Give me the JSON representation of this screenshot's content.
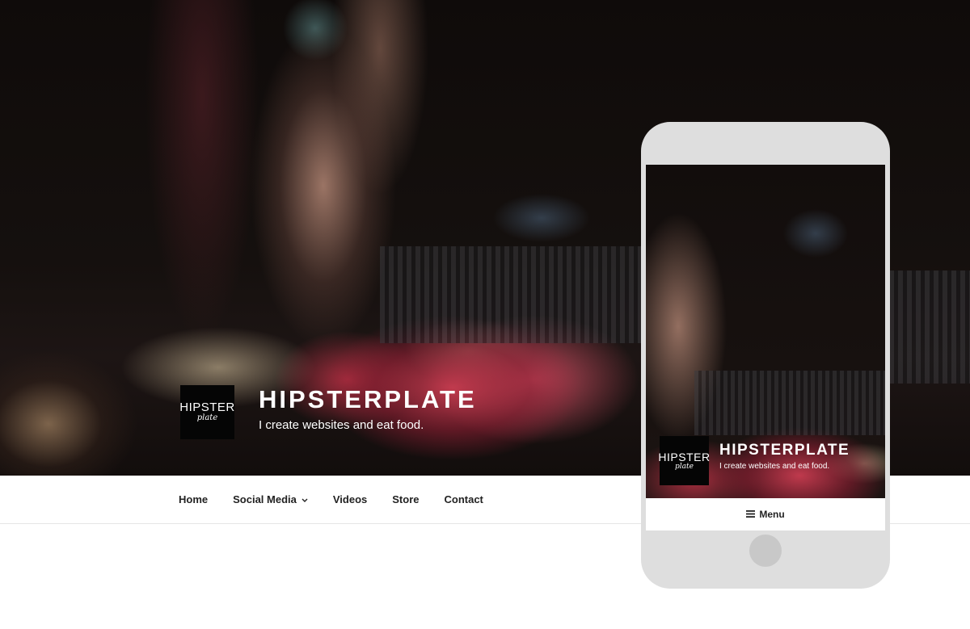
{
  "site": {
    "logo_line1": "HIPSTER",
    "logo_line2": "plate",
    "title": "HIPSTERPLATE",
    "tagline": "I create websites and eat food."
  },
  "nav": {
    "items": [
      {
        "label": "Home"
      },
      {
        "label": "Social Media",
        "has_submenu": true
      },
      {
        "label": "Videos"
      },
      {
        "label": "Store"
      },
      {
        "label": "Contact"
      }
    ],
    "chevron_icon": "chevron-down-icon"
  },
  "mobile": {
    "logo_line1": "HIPSTER",
    "logo_line2": "plate",
    "title": "HIPSTERPLATE",
    "tagline": "I create websites and eat food.",
    "menu_label": "Menu",
    "menu_icon": "hamburger-icon"
  },
  "colors": {
    "nav_text": "#222222",
    "logo_bg": "#050505",
    "phone_frame": "#dedede"
  }
}
